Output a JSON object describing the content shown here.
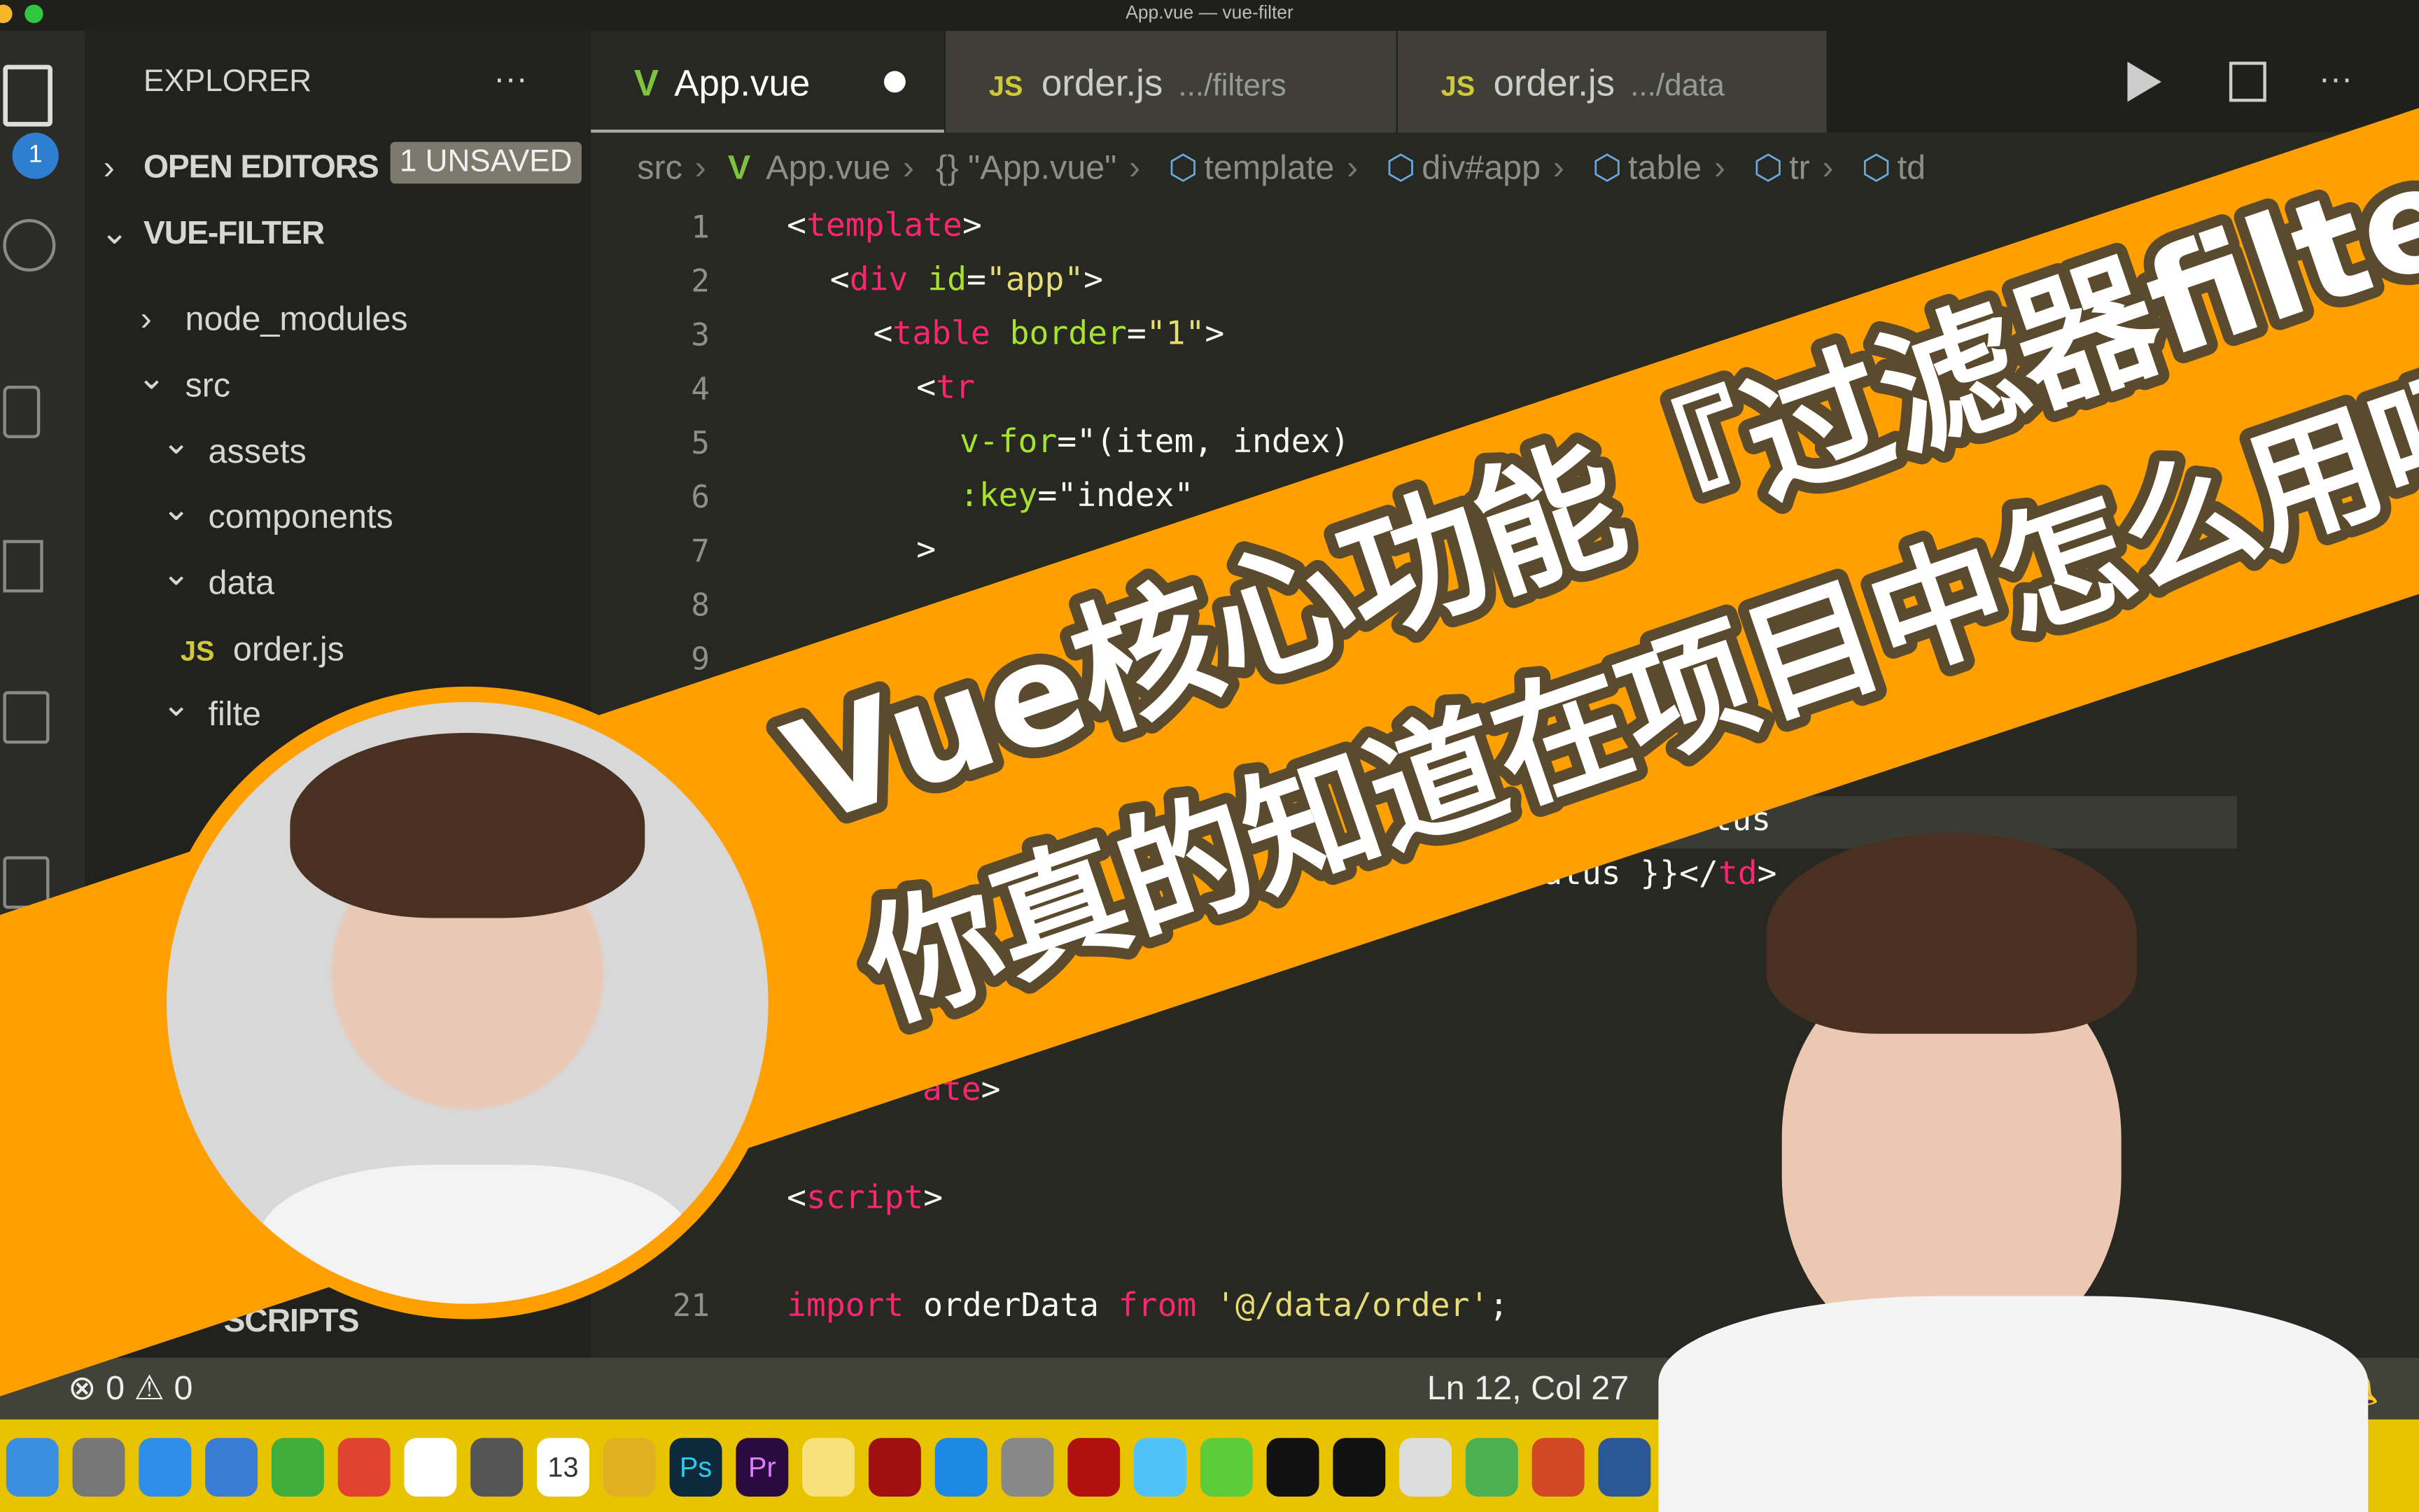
{
  "window": {
    "title": "App.vue — vue-filter"
  },
  "activity_bar": {
    "explorer_badge": "1",
    "icons": [
      "files-icon",
      "search-icon",
      "source-control-icon",
      "run-debug-icon",
      "extensions-icon",
      "remote-icon"
    ]
  },
  "sidebar": {
    "title": "EXPLORER",
    "more": "···",
    "open_editors": "OPEN EDITORS",
    "unsaved_badge": "1 UNSAVED",
    "project": "VUE-FILTER",
    "tree": [
      {
        "label": "node_modules",
        "icon": "chevron-right-icon"
      },
      {
        "label": "src",
        "icon": "chevron-down-icon"
      },
      {
        "label": "assets",
        "icon": "chevron-down-icon"
      },
      {
        "label": "components",
        "icon": "chevron-down-icon"
      },
      {
        "label": "data",
        "icon": "chevron-down-icon"
      },
      {
        "label": "order.js",
        "icon": "js-file-icon"
      },
      {
        "label": "filte",
        "icon": "chevron-down-icon"
      }
    ],
    "npm_scripts": "SCRIPTS"
  },
  "tabs": [
    {
      "label": "App.vue",
      "icon": "vue-icon",
      "modified": true,
      "active": true
    },
    {
      "label": "order.js",
      "path": ".../filters",
      "icon": "js-icon"
    },
    {
      "label": "order.js",
      "path": ".../data",
      "icon": "js-icon"
    }
  ],
  "tab_actions": [
    "run-icon",
    "split-editor-icon",
    "more-icon"
  ],
  "breadcrumb": [
    "src",
    "App.vue",
    "{}",
    "\"App.vue\"",
    "template",
    "div#app",
    "table",
    "tr",
    "td"
  ],
  "code": {
    "line_numbers": [
      "1",
      "2",
      "3",
      "4",
      "5",
      "6",
      "7",
      "8",
      "9",
      "21"
    ],
    "l1": "template",
    "l2a": "div",
    "l2b": "id",
    "l2c": "\"app\"",
    "l3a": "table",
    "l3b": "border",
    "l3c": "\"1\"",
    "l4": "tr",
    "l5a": "v-for",
    "l5b": "\"(item, index) ",
    "l6a": ":key",
    "l6b": "\"index\"",
    "l7": ">",
    "l12": "tus",
    "l13a": "atus }}</",
    "l13b": "td",
    "l17": "ate",
    "l19": "script",
    "l21a": "import",
    "l21b": " orderData ",
    "l21c": "from",
    "l21d": " '@/data/order'",
    ";": ";"
  },
  "status": {
    "errors": "0",
    "warnings": "0",
    "position": "Ln 12, Col 27",
    "partial": "S"
  },
  "dock": {
    "apps": [
      "finder",
      "launchpad",
      "safari",
      "xcode",
      "paper-plane",
      "chrome",
      "baidu-netdisk",
      "notes-app",
      "calendar",
      "star-app",
      "photoshop",
      "premiere",
      "stickies",
      "eye-app",
      "app-store",
      "system-preferences",
      "filezilla",
      "vpn-app",
      "wechat",
      "qq",
      "terminal",
      "settings-gear",
      "camtasia",
      "powerpoint",
      "word"
    ],
    "calendar_day": "13",
    "ps": "Ps",
    "pr": "Pr"
  },
  "banner": {
    "line1": "Vue核心功能『过滤器filter』",
    "line2": "你真的知道在项目中怎么用吗？",
    "color": "#ffa000",
    "outline": "#5a4a2e"
  }
}
